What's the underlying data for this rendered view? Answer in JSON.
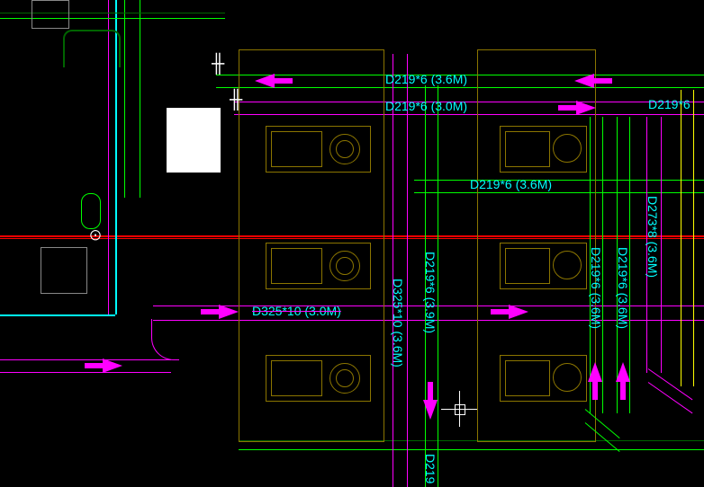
{
  "labels": {
    "top1": "D219*6 (3.6M)",
    "top2": "D219*6 (3.0M)",
    "top_right": "D219*6",
    "mid1": "D219*6 (3.6M)",
    "mid_strike": "D325*10 (3.0M)",
    "v1": "D325*10 (3.6M)",
    "v2": "D219*6 (3.9M)",
    "v3": "D219*6 (3.6M)",
    "v4": "D219*6 (3.6M)",
    "v5": "D273*8 (3.6M)",
    "bottom": "D219"
  }
}
